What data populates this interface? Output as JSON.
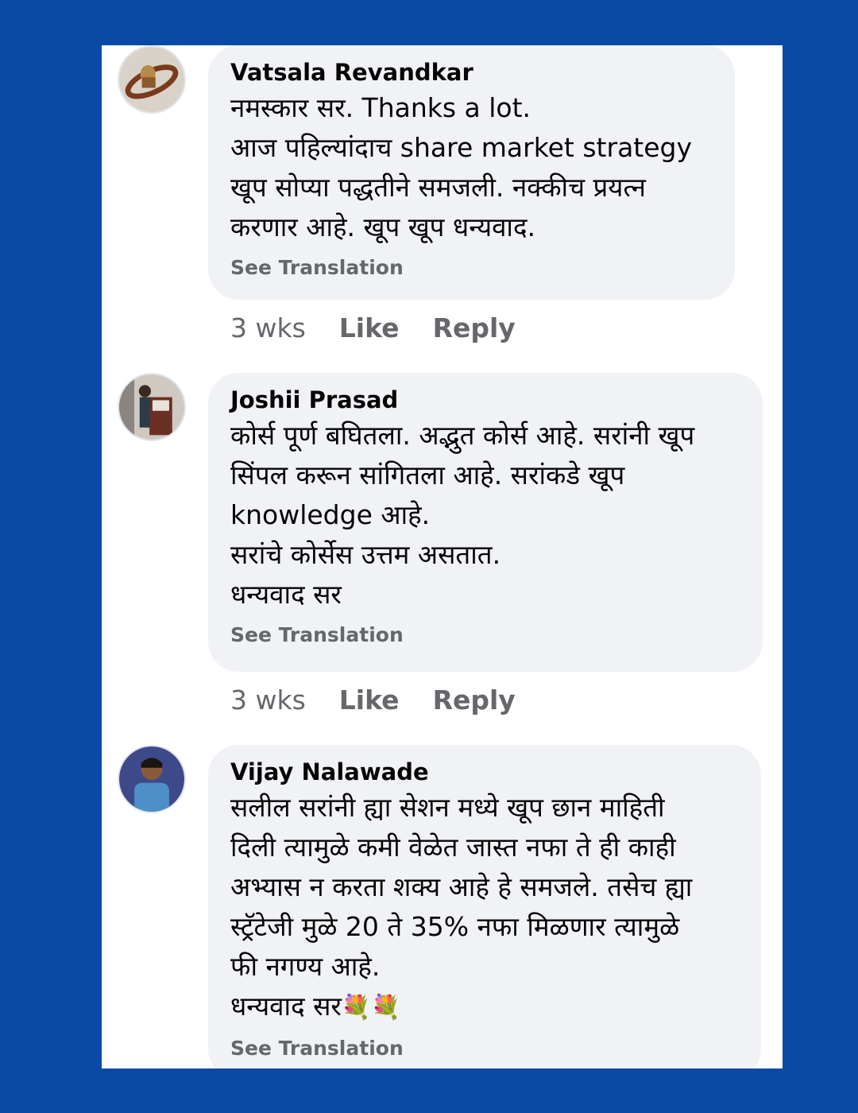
{
  "comments": [
    {
      "author": "Vatsala Revandkar",
      "lines": [
        "नमस्कार सर. Thanks a lot.",
        "आज पहिल्यांदाच share market strategy",
        "खूप सोप्या पद्धतीने समजली. नक्कीच प्रयत्न",
        "करणार आहे. खूप खूप धन्यवाद."
      ],
      "see_translation": "See Translation",
      "time": "3 wks",
      "like": "Like",
      "reply": "Reply"
    },
    {
      "author": "Joshii Prasad",
      "lines": [
        "कोर्स पूर्ण बघितला. अद्भुत कोर्स आहे. सरांनी खूप",
        "सिंपल करून सांगितला आहे. सरांकडे खूप",
        "knowledge आहे.",
        "सरांचे कोर्सेस उत्तम असतात.",
        "धन्यवाद सर"
      ],
      "see_translation": "See Translation",
      "time": "3 wks",
      "like": "Like",
      "reply": "Reply"
    },
    {
      "author": "Vijay Nalawade",
      "lines": [
        "सलील सरांनी ह्या सेशन मध्ये खूप छान माहिती",
        "दिली त्यामुळे कमी वेळेत जास्त नफा ते ही काही",
        "अभ्यास न करता शक्य आहे हे समजले. तसेच ह्या",
        "स्ट्रॅटेजी मुळे 20 ते 35% नफा मिळणार त्यामुळे",
        "फी नगण्य आहे."
      ],
      "last_line": "धन्यवाद सर",
      "emoji": "💐💐",
      "see_translation": "See Translation"
    }
  ],
  "colors": {
    "frame": "#0a4aa6",
    "bubble": "#f0f2f5",
    "text": "#050505",
    "muted": "#65676b"
  }
}
